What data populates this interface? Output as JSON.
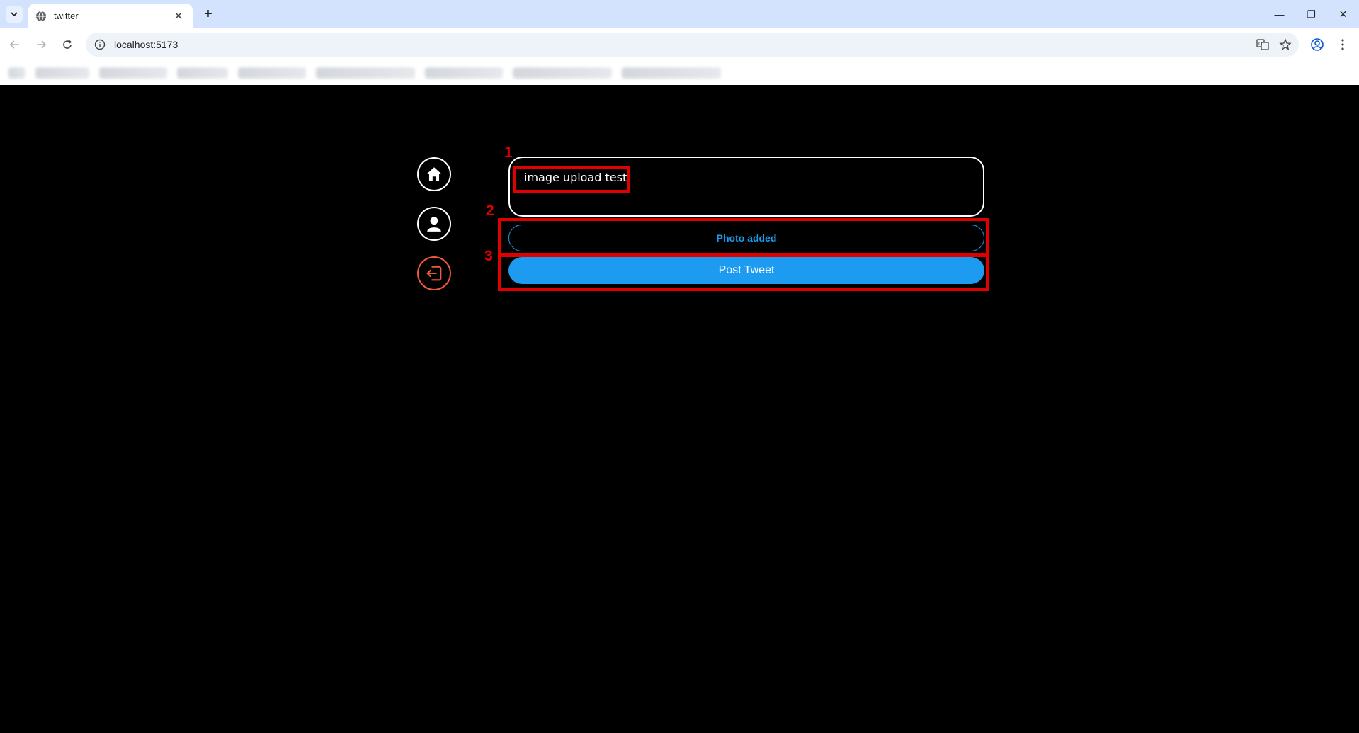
{
  "browser": {
    "tab_title": "twitter",
    "tab_close_glyph": "✕",
    "new_tab_glyph": "+",
    "url": "localhost:5173",
    "window_controls": {
      "minimize": "—",
      "restore": "❐",
      "close": "✕"
    }
  },
  "compose": {
    "tweet_text": "image upload test",
    "photo_button_label": "Photo added",
    "post_button_label": "Post Tweet"
  },
  "annotations": {
    "first": "1",
    "second": "2",
    "third": "3"
  },
  "colors": {
    "accent": "#1d9bf0",
    "logout": "#f05a3a",
    "annotation": "#e00000",
    "background": "#000000"
  },
  "icons": {
    "home": "home-icon",
    "profile": "user-icon",
    "logout": "logout-icon"
  }
}
